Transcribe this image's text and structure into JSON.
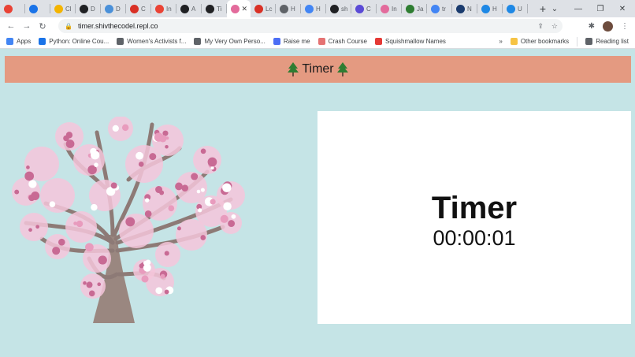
{
  "browser": {
    "tabs": [
      {
        "label": "",
        "color": "#e94235"
      },
      {
        "label": "",
        "color": "#1a73e8"
      },
      {
        "label": "Cl",
        "color": "#f4b400"
      },
      {
        "label": "D",
        "color": "#202124"
      },
      {
        "label": "D",
        "color": "#4a90d9"
      },
      {
        "label": "C",
        "color": "#d93025"
      },
      {
        "label": "In",
        "color": "#ea4335"
      },
      {
        "label": "A",
        "color": "#202124"
      },
      {
        "label": "Ti",
        "color": "#202124"
      },
      {
        "label": "",
        "color": "#e36b9c",
        "active": true
      },
      {
        "label": "Lc",
        "color": "#d93025"
      },
      {
        "label": "H",
        "color": "#5f6368"
      },
      {
        "label": "H",
        "color": "#4285f4"
      },
      {
        "label": "sh",
        "color": "#202124"
      },
      {
        "label": "C",
        "color": "#5b4bd6"
      },
      {
        "label": "In",
        "color": "#e36b9c"
      },
      {
        "label": "Ja",
        "color": "#2e7d32"
      },
      {
        "label": "tr",
        "color": "#4285f4"
      },
      {
        "label": "N",
        "color": "#1a3b6e"
      },
      {
        "label": "H",
        "color": "#1e88e5"
      },
      {
        "label": "U",
        "color": "#1e88e5"
      }
    ],
    "new_tab": "+",
    "window_controls": {
      "dropdown": "⌄",
      "minimize": "—",
      "restore": "❐",
      "close": "✕"
    },
    "nav": {
      "back": "←",
      "forward": "→",
      "reload": "↻"
    },
    "url": "timer.shivthecodel.repl.co",
    "bookmarks": [
      {
        "label": "Apps",
        "color": "#4285f4"
      },
      {
        "label": "Python: Online Cou...",
        "color": "#1a73e8"
      },
      {
        "label": "Women's Activists f...",
        "color": "#5f6368"
      },
      {
        "label": "My Very Own Perso...",
        "color": "#5f6368"
      },
      {
        "label": "Raise me",
        "color": "#4c6ef5"
      },
      {
        "label": "Crash Course",
        "color": "#e57373"
      },
      {
        "label": "Squishmallow Names",
        "color": "#e53935"
      }
    ],
    "overflow": "»",
    "other_bookmarks": "Other bookmarks",
    "reading_list": "Reading list"
  },
  "page": {
    "header_title": "Timer",
    "header_bg": "#e49a81",
    "background": "#c5e4e6",
    "card_title": "Timer",
    "clock": "00:00:01"
  }
}
